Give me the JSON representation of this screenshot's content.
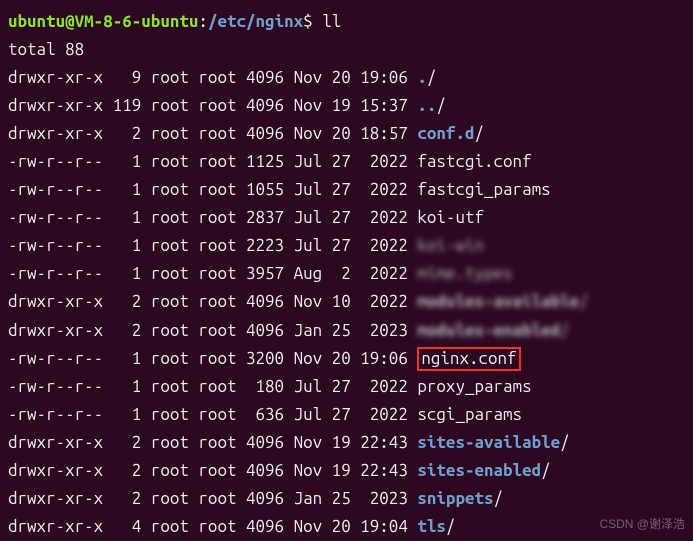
{
  "prompt": {
    "user": "ubuntu@VM-8-6-ubuntu",
    "sep1": ":",
    "path": "/etc/nginx",
    "sep2": "$ ",
    "command": "ll"
  },
  "total_line": "total 88",
  "rows": [
    {
      "perms": "drwxr-xr-x",
      "links": "  9",
      "owner": "root",
      "group": "root",
      "size": "4096",
      "date": "Nov 20 19:06",
      "name": ".",
      "slash": "/",
      "type": "dir",
      "blurred": false,
      "boxed": false
    },
    {
      "perms": "drwxr-xr-x",
      "links": "119",
      "owner": "root",
      "group": "root",
      "size": "4096",
      "date": "Nov 19 15:37",
      "name": "..",
      "slash": "/",
      "type": "dir",
      "blurred": false,
      "boxed": false
    },
    {
      "perms": "drwxr-xr-x",
      "links": "  2",
      "owner": "root",
      "group": "root",
      "size": "4096",
      "date": "Nov 20 18:57",
      "name": "conf.d",
      "slash": "/",
      "type": "dir",
      "blurred": false,
      "boxed": false
    },
    {
      "perms": "-rw-r--r--",
      "links": "  1",
      "owner": "root",
      "group": "root",
      "size": "1125",
      "date": "Jul 27  2022",
      "name": "fastcgi.conf",
      "slash": "",
      "type": "file",
      "blurred": false,
      "boxed": false
    },
    {
      "perms": "-rw-r--r--",
      "links": "  1",
      "owner": "root",
      "group": "root",
      "size": "1055",
      "date": "Jul 27  2022",
      "name": "fastcgi_params",
      "slash": "",
      "type": "file",
      "blurred": false,
      "boxed": false
    },
    {
      "perms": "-rw-r--r--",
      "links": "  1",
      "owner": "root",
      "group": "root",
      "size": "2837",
      "date": "Jul 27  2022",
      "name": "koi-utf",
      "slash": "",
      "type": "file",
      "blurred": false,
      "boxed": false
    },
    {
      "perms": "-rw-r--r--",
      "links": "  1",
      "owner": "root",
      "group": "root",
      "size": "2223",
      "date": "Jul 27  2022",
      "name": "koi-win",
      "slash": "",
      "type": "file",
      "blurred": true,
      "boxed": false
    },
    {
      "perms": "-rw-r--r--",
      "links": "  1",
      "owner": "root",
      "group": "root",
      "size": "3957",
      "date": "Aug  2  2022",
      "name": "mime.types",
      "slash": "",
      "type": "file",
      "blurred": true,
      "boxed": false
    },
    {
      "perms": "drwxr-xr-x",
      "links": "  2",
      "owner": "root",
      "group": "root",
      "size": "4096",
      "date": "Nov 10  2022",
      "name": "modules-available",
      "slash": "/",
      "type": "dir",
      "blurred": true,
      "boxed": false
    },
    {
      "perms": "drwxr-xr-x",
      "links": "  2",
      "owner": "root",
      "group": "root",
      "size": "4096",
      "date": "Jan 25  2023",
      "name": "modules-enabled",
      "slash": "/",
      "type": "dir",
      "blurred": true,
      "boxed": false
    },
    {
      "perms": "-rw-r--r--",
      "links": "  1",
      "owner": "root",
      "group": "root",
      "size": "3200",
      "date": "Nov 20 19:06",
      "name": "nginx.conf",
      "slash": "",
      "type": "file",
      "blurred": false,
      "boxed": true
    },
    {
      "perms": "-rw-r--r--",
      "links": "  1",
      "owner": "root",
      "group": "root",
      "size": " 180",
      "date": "Jul 27  2022",
      "name": "proxy_params",
      "slash": "",
      "type": "file",
      "blurred": false,
      "boxed": false
    },
    {
      "perms": "-rw-r--r--",
      "links": "  1",
      "owner": "root",
      "group": "root",
      "size": " 636",
      "date": "Jul 27  2022",
      "name": "scgi_params",
      "slash": "",
      "type": "file",
      "blurred": false,
      "boxed": false
    },
    {
      "perms": "drwxr-xr-x",
      "links": "  2",
      "owner": "root",
      "group": "root",
      "size": "4096",
      "date": "Nov 19 22:43",
      "name": "sites-available",
      "slash": "/",
      "type": "dir",
      "blurred": false,
      "boxed": false
    },
    {
      "perms": "drwxr-xr-x",
      "links": "  2",
      "owner": "root",
      "group": "root",
      "size": "4096",
      "date": "Nov 19 22:43",
      "name": "sites-enabled",
      "slash": "/",
      "type": "dir",
      "blurred": false,
      "boxed": false
    },
    {
      "perms": "drwxr-xr-x",
      "links": "  2",
      "owner": "root",
      "group": "root",
      "size": "4096",
      "date": "Jan 25  2023",
      "name": "snippets",
      "slash": "/",
      "type": "dir",
      "blurred": false,
      "boxed": false
    },
    {
      "perms": "drwxr-xr-x",
      "links": "  4",
      "owner": "root",
      "group": "root",
      "size": "4096",
      "date": "Nov 20 19:04",
      "name": "tls",
      "slash": "/",
      "type": "dir",
      "blurred": false,
      "boxed": false
    }
  ],
  "watermark": "CSDN @谢泽浩"
}
